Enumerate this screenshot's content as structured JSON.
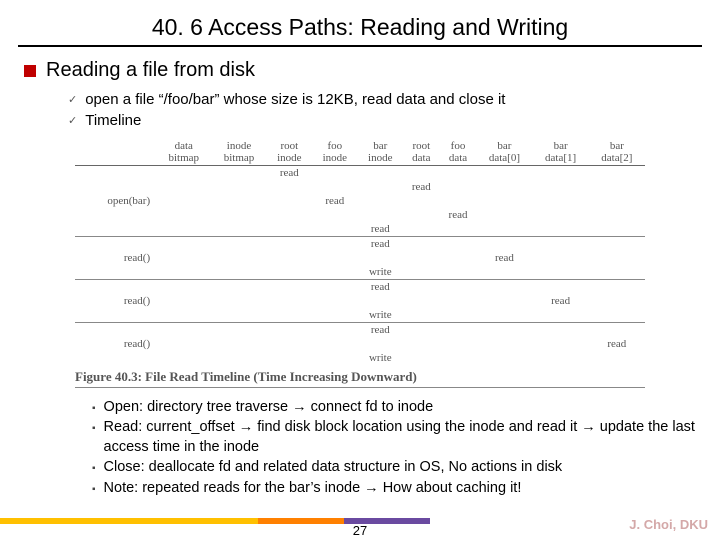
{
  "title": "40. 6 Access Paths: Reading and Writing",
  "h1": "Reading a file from disk",
  "sub": {
    "a": "open a file “/foo/bar” whose size is 12KB, read data and close it",
    "b": "Timeline"
  },
  "fig": {
    "cols": {
      "rowlabel": "",
      "c0": {
        "l1": "data",
        "l2": "bitmap"
      },
      "c1": {
        "l1": "inode",
        "l2": "bitmap"
      },
      "c2": {
        "l1": "root",
        "l2": "inode"
      },
      "c3": {
        "l1": "foo",
        "l2": "inode"
      },
      "c4": {
        "l1": "bar",
        "l2": "inode"
      },
      "c5": {
        "l1": "root",
        "l2": "data"
      },
      "c6": {
        "l1": "foo",
        "l2": "data"
      },
      "c7": {
        "l1": "bar",
        "l2": "data[0]"
      },
      "c8": {
        "l1": "bar",
        "l2": "data[1]"
      },
      "c9": {
        "l1": "bar",
        "l2": "data[2]"
      }
    },
    "rows": {
      "open": "open(bar)",
      "read0": "read()",
      "read1": "read()",
      "read2": "read()"
    },
    "cell_read": "read",
    "cell_write": "write",
    "caption": "Figure 40.3: File Read Timeline (Time Increasing Downward)"
  },
  "notes": {
    "n0": "Open: directory tree traverse → connect fd to inode",
    "n1": "Read: current_offset → find disk block location using the inode and read it → update the last access time in the inode",
    "n2": "Close: deallocate fd and related data structure in OS, No actions in disk",
    "n3": "Note: repeated reads for the bar’s inode → How about caching it!"
  },
  "page": "27",
  "credit": "J. Choi, DKU"
}
